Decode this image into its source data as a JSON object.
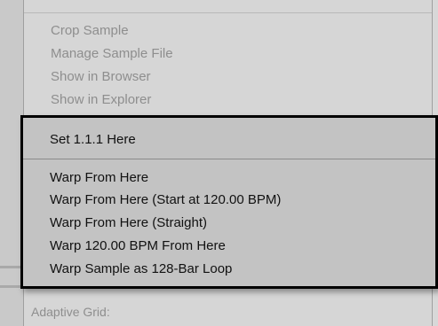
{
  "menu": {
    "top_items": [
      {
        "label": "Crop Sample",
        "enabled": false
      },
      {
        "label": "Manage Sample File",
        "enabled": false
      },
      {
        "label": "Show in Browser",
        "enabled": false
      },
      {
        "label": "Show in Explorer",
        "enabled": false
      }
    ],
    "set_item": {
      "label": "Set 1.1.1 Here"
    },
    "warp_items": [
      {
        "label": "Warp From Here"
      },
      {
        "label": "Warp From Here (Start at 120.00 BPM)"
      },
      {
        "label": "Warp From Here (Straight)"
      },
      {
        "label": "Warp 120.00 BPM From Here"
      },
      {
        "label": "Warp Sample as 128-Bar Loop"
      }
    ]
  },
  "footer": {
    "label": "Adaptive Grid:"
  }
}
